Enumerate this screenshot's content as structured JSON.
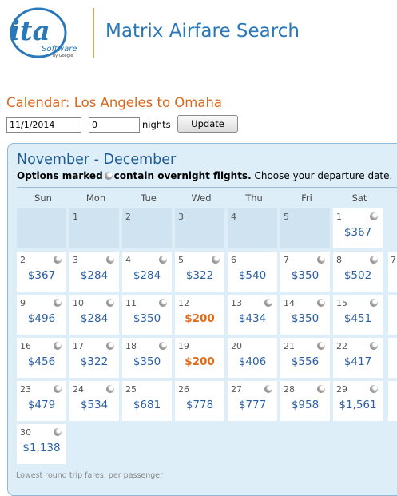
{
  "header": {
    "logo_text": "ita",
    "logo_sub": "Software",
    "logo_by": "by Google",
    "title": "Matrix Airfare Search"
  },
  "calendar": {
    "heading": "Calendar: Los Angeles to Omaha",
    "date_value": "11/1/2014",
    "nights_value": "0",
    "nights_label": "nights",
    "update_label": "Update",
    "month_title": "November - December",
    "note_bold_1": "Options marked",
    "note_bold_2": "contain overnight flights.",
    "note_rest": "Choose your departure date.",
    "days_of_week": [
      "Sun",
      "Mon",
      "Tue",
      "Wed",
      "Thu",
      "Fri",
      "Sat"
    ],
    "footnote": "Lowest round trip fares, per passenger",
    "cells": [
      {
        "day": "",
        "price": "",
        "overnight": false,
        "empty": true
      },
      {
        "day": "1",
        "price": "",
        "overnight": false,
        "empty": true
      },
      {
        "day": "2",
        "price": "",
        "overnight": false,
        "empty": true
      },
      {
        "day": "3",
        "price": "",
        "overnight": false,
        "empty": true
      },
      {
        "day": "4",
        "price": "",
        "overnight": false,
        "empty": true
      },
      {
        "day": "5",
        "price": "",
        "overnight": false,
        "empty": true
      },
      {
        "day": "1",
        "price": "$367",
        "overnight": true
      },
      {
        "day": "2",
        "price": "$367",
        "overnight": true
      },
      {
        "day": "3",
        "price": "$284",
        "overnight": true
      },
      {
        "day": "4",
        "price": "$284",
        "overnight": true
      },
      {
        "day": "5",
        "price": "$322",
        "overnight": true
      },
      {
        "day": "6",
        "price": "$540",
        "overnight": false
      },
      {
        "day": "7",
        "price": "$350",
        "overnight": true
      },
      {
        "day": "8",
        "price": "$502",
        "overnight": true
      },
      {
        "day": "9",
        "price": "$496",
        "overnight": true
      },
      {
        "day": "10",
        "price": "$284",
        "overnight": true
      },
      {
        "day": "11",
        "price": "$350",
        "overnight": true
      },
      {
        "day": "12",
        "price": "$200",
        "overnight": false,
        "low": true
      },
      {
        "day": "13",
        "price": "$434",
        "overnight": true
      },
      {
        "day": "14",
        "price": "$350",
        "overnight": true
      },
      {
        "day": "15",
        "price": "$451",
        "overnight": true
      },
      {
        "day": "16",
        "price": "$456",
        "overnight": true
      },
      {
        "day": "17",
        "price": "$322",
        "overnight": true
      },
      {
        "day": "18",
        "price": "$350",
        "overnight": true
      },
      {
        "day": "19",
        "price": "$200",
        "overnight": false,
        "low": true
      },
      {
        "day": "20",
        "price": "$406",
        "overnight": false
      },
      {
        "day": "21",
        "price": "$556",
        "overnight": true
      },
      {
        "day": "22",
        "price": "$417",
        "overnight": true
      },
      {
        "day": "23",
        "price": "$479",
        "overnight": true
      },
      {
        "day": "24",
        "price": "$534",
        "overnight": true
      },
      {
        "day": "25",
        "price": "$681",
        "overnight": false
      },
      {
        "day": "26",
        "price": "$778",
        "overnight": false
      },
      {
        "day": "27",
        "price": "$777",
        "overnight": true
      },
      {
        "day": "28",
        "price": "$958",
        "overnight": true
      },
      {
        "day": "29",
        "price": "$1,561",
        "overnight": true
      },
      {
        "day": "30",
        "price": "$1,138",
        "overnight": true
      }
    ],
    "next_month_days": [
      "7"
    ],
    "colors": {
      "accent_orange": "#d86a20",
      "lowest_price": "#e06c1a",
      "price_blue": "#2a5fa3",
      "panel_bg": "#ddeef8"
    }
  }
}
